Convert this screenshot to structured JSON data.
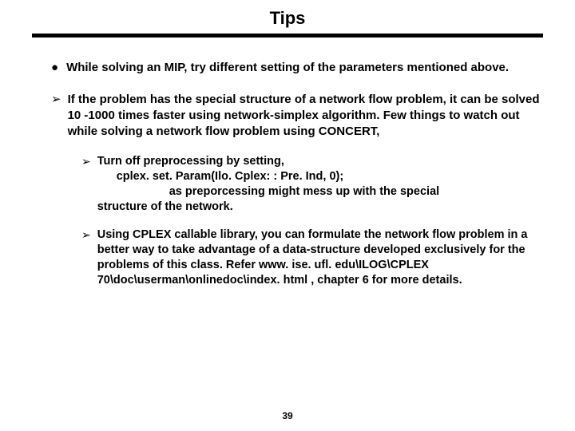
{
  "title": "Tips",
  "bullets": {
    "l1_1": "While solving an MIP, try different setting of the parameters mentioned above.",
    "l2_1": "If the problem has the special structure of a network flow problem, it can be solved 10 -1000 times faster using network-simplex algorithm. Few things to watch out while solving a network flow problem using CONCERT,",
    "l3_1a": "Turn off preprocessing by setting,",
    "l3_1b": "cplex. set. Param(Ilo. Cplex: : Pre. Ind, 0);",
    "l3_1c": "as preporcessing might mess up with the special",
    "l3_1d": "structure of the network.",
    "l3_2": "Using CPLEX callable library, you can formulate the network flow problem in a better way to take advantage of a data-structure developed exclusively for the problems of this class. Refer www. ise. ufl. edu\\ILOG\\CPLEX 70\\doc\\userman\\onlinedoc\\index. html , chapter 6 for more details."
  },
  "markers": {
    "disc": "●",
    "arrow": "➢"
  },
  "page": "39"
}
